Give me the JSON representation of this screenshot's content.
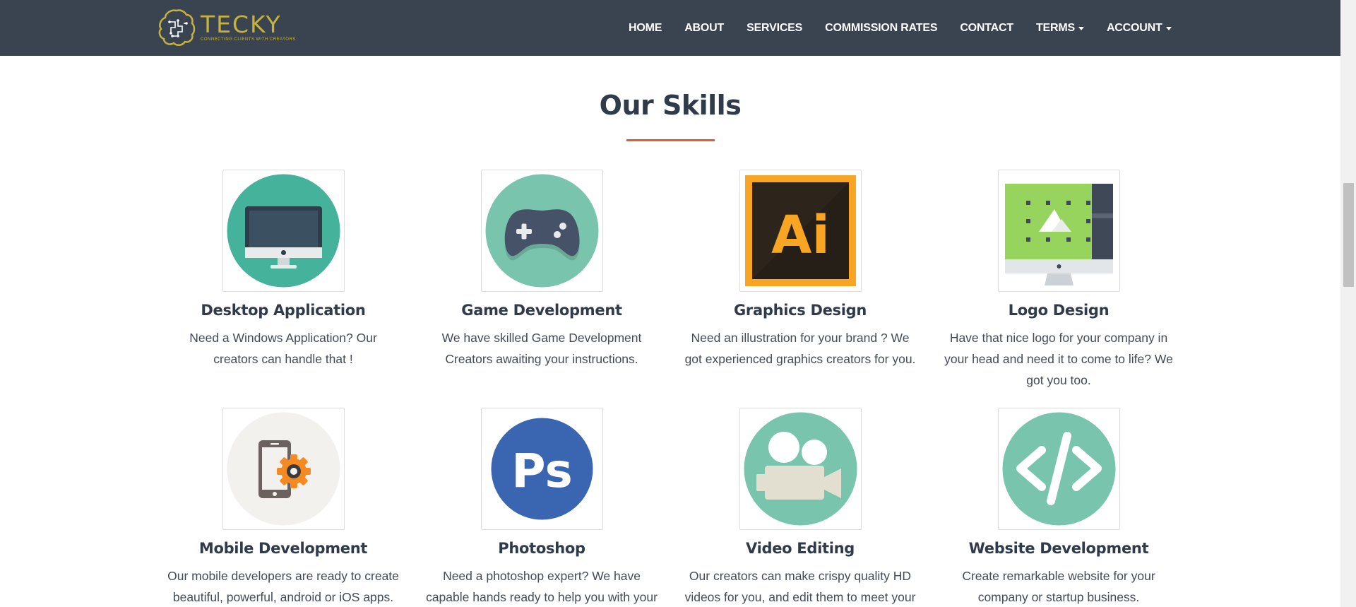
{
  "navbar": {
    "brand_name": "TECKY",
    "brand_tagline": "CONNECTING CLIENTS WITH CREATORS",
    "items": [
      {
        "label": "HOME"
      },
      {
        "label": "ABOUT"
      },
      {
        "label": "SERVICES"
      },
      {
        "label": "COMMISSION RATES"
      },
      {
        "label": "CONTACT"
      },
      {
        "label": "TERMS"
      },
      {
        "label": "ACCOUNT"
      }
    ]
  },
  "section": {
    "title": "Our Skills",
    "accent_color": "#e4592f"
  },
  "skills": [
    {
      "name": "Desktop Application",
      "description": "Need a Windows Application? Our creators can handle that !",
      "icon": "desktop-monitor-icon"
    },
    {
      "name": "Game Development",
      "description": "We have skilled Game Development Creators awaiting your instructions.",
      "icon": "gamepad-icon"
    },
    {
      "name": "Graphics Design",
      "description": "Need an illustration for your brand ? We got experienced graphics creators for you.",
      "icon": "illustrator-ai-icon",
      "icon_text": "Ai"
    },
    {
      "name": "Logo Design",
      "description": "Have that nice logo for your company in your head and need it to come to life? We got you too.",
      "icon": "logo-design-monitor-icon"
    },
    {
      "name": "Mobile Development",
      "description": "Our mobile developers are ready to create beautiful, powerful, android or iOS apps.",
      "icon": "mobile-gear-icon"
    },
    {
      "name": "Photoshop",
      "description": "Need a photoshop expert? We have capable hands ready to help you with your",
      "icon": "photoshop-ps-icon",
      "icon_text": "Ps"
    },
    {
      "name": "Video Editing",
      "description": "Our creators can make crispy quality HD videos for you, and edit them to meet your",
      "icon": "video-camera-icon"
    },
    {
      "name": "Website Development",
      "description": "Create remarkable website for your company or startup business.",
      "icon": "code-brackets-icon"
    }
  ]
}
